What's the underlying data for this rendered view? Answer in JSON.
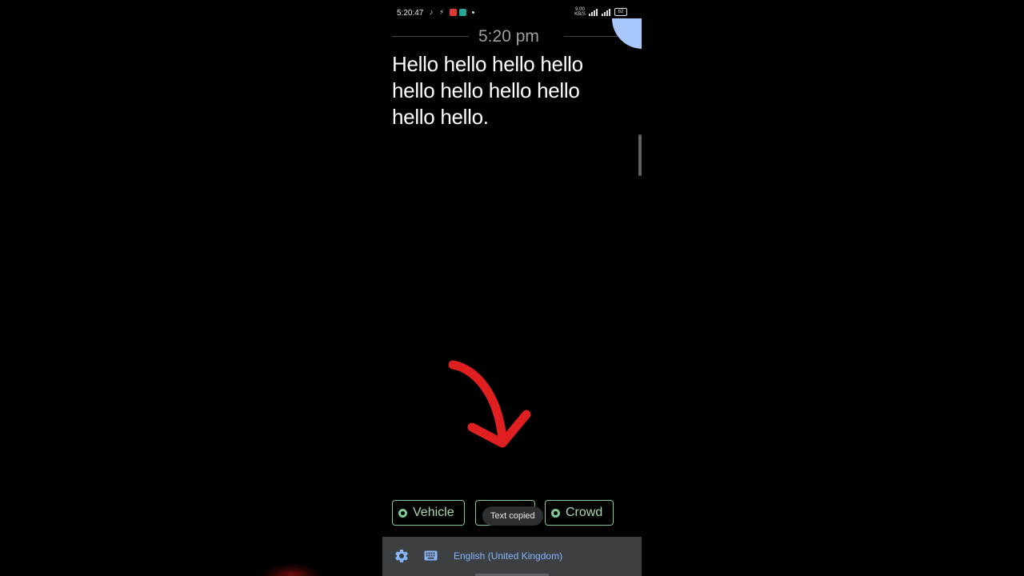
{
  "status_bar": {
    "time": "5:20:47",
    "battery": "62",
    "speed": "9.00 KB/S",
    "icons": [
      "tiktok-icon",
      "mute-icon",
      "red-app-icon",
      "teal-app-icon",
      "dot-icon",
      "signal-icon",
      "signal-icon",
      "battery-icon"
    ]
  },
  "conversation": {
    "time": "5:20 pm",
    "transcript": "Hello hello hello hello hello hello hello hello hello hello."
  },
  "chips": {
    "vehicle": "Vehicle",
    "crowd": "Crowd"
  },
  "toast": {
    "text": "Text copied"
  },
  "toolbar": {
    "language": "English (United Kingdom)",
    "icons": [
      "gear-icon",
      "keyboard-icon"
    ]
  },
  "colors": {
    "accent_green": "#81c995",
    "accent_blue": "#a8c7fa",
    "link_blue": "#8ab4f8",
    "arrow_red": "#e02020",
    "toolbar_bg": "#3c4043"
  }
}
